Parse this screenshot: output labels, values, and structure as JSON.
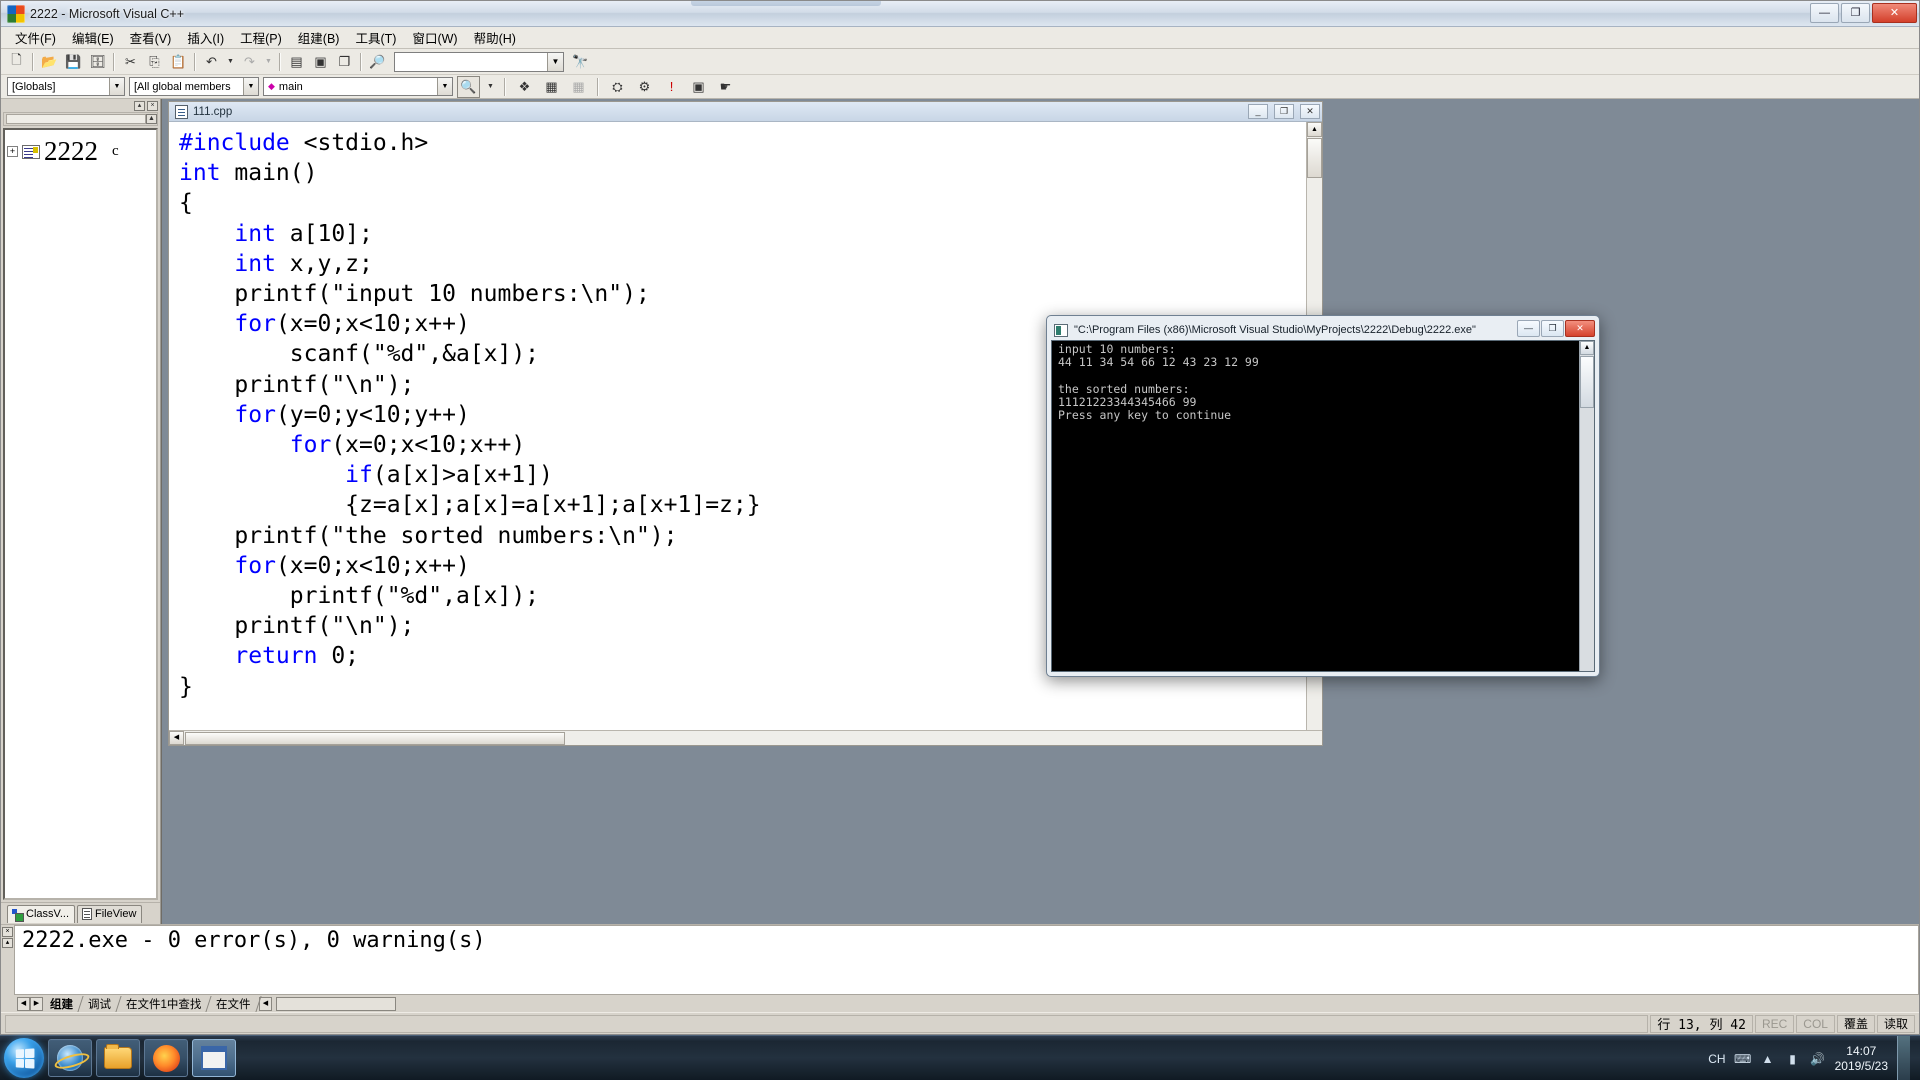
{
  "window": {
    "title": "2222 - Microsoft Visual C++",
    "minimize": "—",
    "maximize": "❐",
    "close": "✕"
  },
  "menubar": {
    "items": [
      {
        "label": "文件(F)"
      },
      {
        "label": "编辑(E)"
      },
      {
        "label": "查看(V)"
      },
      {
        "label": "插入(I)"
      },
      {
        "label": "工程(P)"
      },
      {
        "label": "组建(B)"
      },
      {
        "label": "工具(T)"
      },
      {
        "label": "窗口(W)"
      },
      {
        "label": "帮助(H)"
      }
    ]
  },
  "toolbar": {
    "buttons": [
      {
        "name": "new-document-icon",
        "glyph": "🗋"
      },
      {
        "name": "open-folder-icon",
        "glyph": "📂"
      },
      {
        "name": "save-icon",
        "glyph": "💾"
      },
      {
        "name": "save-all-icon",
        "glyph": "🗄"
      },
      {
        "name": "cut-icon",
        "glyph": "✂"
      },
      {
        "name": "copy-icon",
        "glyph": "⎘"
      },
      {
        "name": "paste-icon",
        "glyph": "📋"
      },
      {
        "name": "undo-icon",
        "glyph": "↶"
      },
      {
        "name": "redo-icon",
        "glyph": "↷"
      },
      {
        "name": "workspace-icon",
        "glyph": "▤"
      },
      {
        "name": "output-window-icon",
        "glyph": "▣"
      },
      {
        "name": "window-list-icon",
        "glyph": "❐"
      },
      {
        "name": "find-in-files-icon",
        "glyph": "🔎"
      }
    ],
    "search_value": "",
    "search_arrow": "▼",
    "binoculars": "🔭"
  },
  "wizardbar": {
    "globals": "[Globals]",
    "members": "[All global members",
    "symbol": "main",
    "symbol_dot": "◆",
    "arrow": "▼"
  },
  "sidebar": {
    "tree": {
      "expander": "+",
      "project": "2222",
      "suffix": "c"
    },
    "tabs": [
      {
        "label": "ClassV...",
        "active": true
      },
      {
        "label": "FileView",
        "active": false
      }
    ]
  },
  "editor": {
    "tab_title": "111.cpp",
    "caption_buttons": {
      "minimize": "_",
      "maximize": "❐",
      "close": "✕"
    },
    "code_lines": [
      {
        "segments": [
          {
            "t": "#include",
            "k": true
          },
          {
            "t": " <stdio.h>",
            "k": false
          }
        ]
      },
      {
        "segments": [
          {
            "t": "int",
            "k": true
          },
          {
            "t": " main()",
            "k": false
          }
        ]
      },
      {
        "segments": [
          {
            "t": "{",
            "k": false
          }
        ]
      },
      {
        "segments": [
          {
            "t": "    ",
            "k": false
          },
          {
            "t": "int",
            "k": true
          },
          {
            "t": " a[10];",
            "k": false
          }
        ]
      },
      {
        "segments": [
          {
            "t": "    ",
            "k": false
          },
          {
            "t": "int",
            "k": true
          },
          {
            "t": " x,y,z;",
            "k": false
          }
        ]
      },
      {
        "segments": [
          {
            "t": "    printf(\"input 10 numbers:\\n\");",
            "k": false
          }
        ]
      },
      {
        "segments": [
          {
            "t": "    ",
            "k": false
          },
          {
            "t": "for",
            "k": true
          },
          {
            "t": "(x=0;x<10;x++)",
            "k": false
          }
        ]
      },
      {
        "segments": [
          {
            "t": "        scanf(\"%d\",&a[x]);",
            "k": false
          }
        ]
      },
      {
        "segments": [
          {
            "t": "    printf(\"\\n\");",
            "k": false
          }
        ]
      },
      {
        "segments": [
          {
            "t": "    ",
            "k": false
          },
          {
            "t": "for",
            "k": true
          },
          {
            "t": "(y=0;y<10;y++)",
            "k": false
          }
        ]
      },
      {
        "segments": [
          {
            "t": "        ",
            "k": false
          },
          {
            "t": "for",
            "k": true
          },
          {
            "t": "(x=0;x<10;x++)",
            "k": false
          }
        ]
      },
      {
        "segments": [
          {
            "t": "            ",
            "k": false
          },
          {
            "t": "if",
            "k": true
          },
          {
            "t": "(a[x]>a[x+1])",
            "k": false
          }
        ]
      },
      {
        "segments": [
          {
            "t": "            {z=a[x];a[x]=a[x+1];a[x+1]=z;}",
            "k": false
          }
        ]
      },
      {
        "segments": [
          {
            "t": "    printf(\"the sorted numbers:\\n\");",
            "k": false
          }
        ]
      },
      {
        "segments": [
          {
            "t": "    ",
            "k": false
          },
          {
            "t": "for",
            "k": true
          },
          {
            "t": "(x=0;x<10;x++)",
            "k": false
          }
        ]
      },
      {
        "segments": [
          {
            "t": "        printf(\"%d\",a[x]);",
            "k": false
          }
        ]
      },
      {
        "segments": [
          {
            "t": "    printf(\"\\n\");",
            "k": false
          }
        ]
      },
      {
        "segments": [
          {
            "t": "    ",
            "k": false
          },
          {
            "t": "return",
            "k": true
          },
          {
            "t": " 0;",
            "k": false
          }
        ]
      },
      {
        "segments": [
          {
            "t": "}",
            "k": false
          }
        ]
      }
    ]
  },
  "console": {
    "title": "\"C:\\Program Files (x86)\\Microsoft Visual Studio\\MyProjects\\2222\\Debug\\2222.exe\"",
    "buttons": {
      "minimize": "—",
      "maximize": "❐",
      "close": "✕"
    },
    "output": "input 10 numbers:\n44 11 34 54 66 12 43 23 12 99\n\nthe sorted numbers:\n11121223344345466 99\nPress any key to continue",
    "lines": [
      "input 10 numbers:",
      "44 11 34 54 66 12 43 23 12 99",
      "",
      "the sorted numbers:",
      "11121223344345466 99",
      "Press any key to continue"
    ],
    "scroll_up": "▲",
    "scroll_down": "▼"
  },
  "output": {
    "text": "2222.exe - 0 error(s), 0 warning(s)",
    "tabs": [
      {
        "label": "组建",
        "active": true
      },
      {
        "label": "调试",
        "active": false
      },
      {
        "label": "在文件1中查找",
        "active": false
      },
      {
        "label": "在文件",
        "active": false
      }
    ],
    "nav_prev": "◀",
    "nav_next": "▶",
    "nav_more": "◀",
    "close": "×",
    "restore": "▴"
  },
  "statusbar": {
    "line_col": "行 13, 列 42",
    "rec": "REC",
    "col": "COL",
    "ovr": "覆盖",
    "read": "读取"
  },
  "taskbar": {
    "start": "start-orb",
    "items": [
      {
        "name": "taskbar-ie",
        "label": "Internet Explorer"
      },
      {
        "name": "taskbar-explorer",
        "label": "Windows Explorer"
      },
      {
        "name": "taskbar-firefox",
        "label": "Firefox"
      },
      {
        "name": "taskbar-vcpp",
        "label": "Microsoft Visual C++",
        "active": true
      }
    ],
    "tray": {
      "ime": "CH",
      "keyboard_icon": "⌨",
      "arrow_icon": "▲",
      "network_icon": "▮",
      "volume_icon": "🔊",
      "time": "14:07",
      "date": "2019/5/23"
    }
  }
}
